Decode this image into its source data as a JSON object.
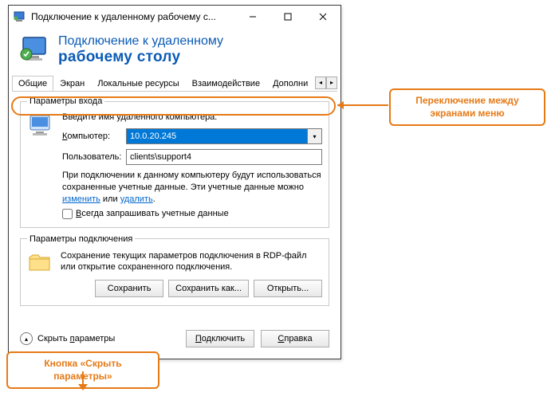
{
  "titlebar": {
    "title": "Подключение к удаленному рабочему с..."
  },
  "header": {
    "line1": "Подключение к удаленному",
    "line2": "рабочему столу"
  },
  "tabs": {
    "items": [
      {
        "label": "Общие"
      },
      {
        "label": "Экран"
      },
      {
        "label": "Локальные ресурсы"
      },
      {
        "label": "Взаимодействие"
      },
      {
        "label": "Дополни"
      }
    ]
  },
  "login": {
    "legend": "Параметры входа",
    "instruction": "Введите имя удаленного компьютера.",
    "computer_label_pre": "К",
    "computer_label_post": "омпьютер:",
    "computer_value": "10.0.20.245",
    "user_label": "Пользователь:",
    "user_value": "clients\\support4",
    "saved_text_1": "При подключении к данному компьютеру будут использоваться сохраненные учетные данные.  Эти учетные данные можно ",
    "saved_link_1": "изменить",
    "saved_text_2": " или ",
    "saved_link_2": "удалить",
    "saved_text_3": ".",
    "checkbox_pre": "В",
    "checkbox_post": "сегда запрашивать учетные данные"
  },
  "conn": {
    "legend": "Параметры подключения",
    "text": "Сохранение текущих параметров подключения в RDP-файл или открытие сохраненного подключения.",
    "save": "Сохранить",
    "save_as": "Сохранить как...",
    "open": "Открыть..."
  },
  "footer": {
    "hide_pre": "Скрыть ",
    "hide_ul": "п",
    "hide_post": "араметры",
    "connect_pre": "П",
    "connect_post": "одключить",
    "help_pre": "С",
    "help_post": "правка"
  },
  "callouts": {
    "tabs_switch_l1": "Переключение между",
    "tabs_switch_l2": "экранами меню",
    "hide_btn": "Кнопка «Скрыть параметры»"
  }
}
